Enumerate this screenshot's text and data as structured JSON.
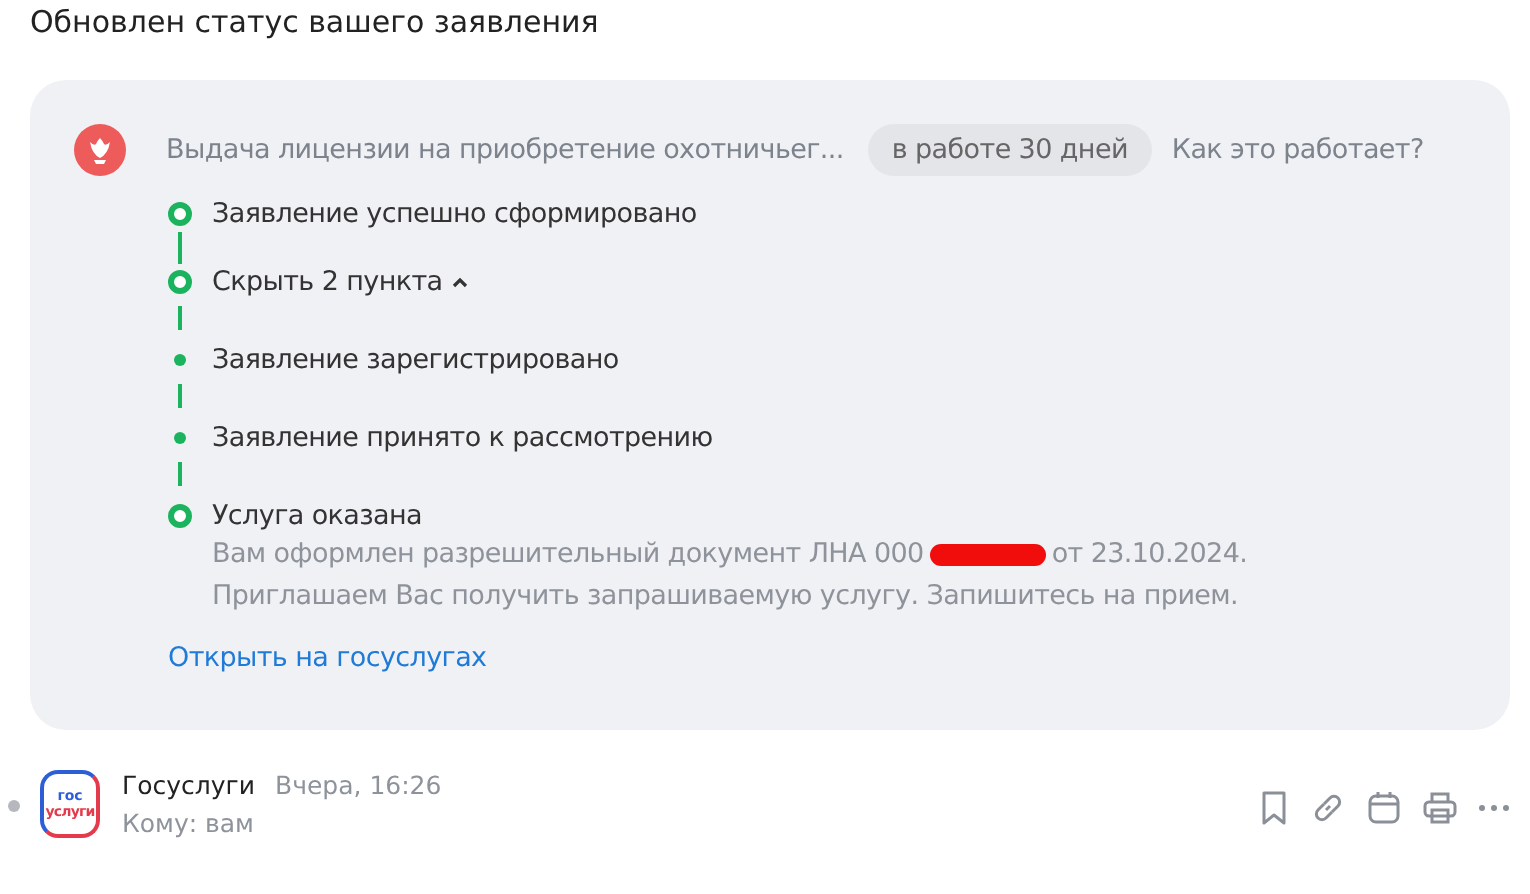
{
  "heading": "Обновлен статус вашего заявления",
  "card": {
    "service": "Выдача лицензии на приобретение охотничьег...",
    "status_pill": "в работе 30 дней",
    "help_link": "Как это работает?",
    "steps": [
      {
        "kind": "major",
        "label": "Заявление успешно сформировано"
      },
      {
        "kind": "toggle",
        "label": "Скрыть 2 пункта",
        "expanded": true
      },
      {
        "kind": "minor",
        "label": "Заявление зарегистрировано"
      },
      {
        "kind": "minor",
        "label": "Заявление принято к рассмотрению"
      },
      {
        "kind": "major",
        "label": "Услуга оказана",
        "detail_start": "Вам оформлен разрешительный документ ЛНА 000",
        "detail_end": "от 23.10.2024.",
        "detail_second": "Приглашаем Вас получить запрашиваемую услугу. Запишитесь на прием."
      }
    ],
    "open_link": "Открыть на госуслугах"
  },
  "message": {
    "unread": true,
    "logo_top": "гос",
    "logo_bottom": "услуги",
    "sender": "Госуслуги",
    "time": "Вчера, 16:26",
    "recipient": "Кому: вам"
  }
}
